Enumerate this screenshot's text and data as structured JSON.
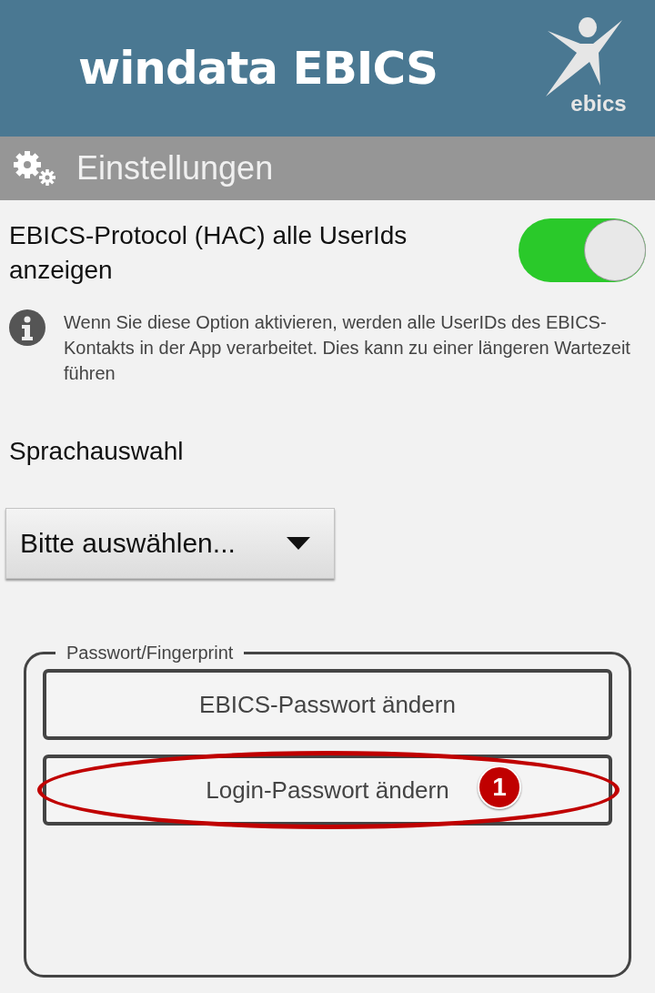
{
  "header": {
    "title": "windata EBICS",
    "logo_text": "ebics"
  },
  "section_bar": {
    "title": "Einstellungen"
  },
  "toggle_setting": {
    "label": "EBICS-Protocol (HAC) alle UserIds anzeigen",
    "on": true
  },
  "info_note": {
    "text": "Wenn Sie diese Option aktivieren, werden alle UserIDs des EBICS-Kontakts in der App verarbeitet. Dies kann zu einer längeren Wartezeit führen"
  },
  "language": {
    "label": "Sprachauswahl",
    "value": "Bitte auswählen..."
  },
  "password_group": {
    "title": "Passwort/Fingerprint",
    "buttons": [
      {
        "label": "EBICS-Passwort ändern",
        "highlighted": false
      },
      {
        "label": "Login-Passwort ändern",
        "highlighted": true,
        "callout": "1"
      }
    ]
  }
}
